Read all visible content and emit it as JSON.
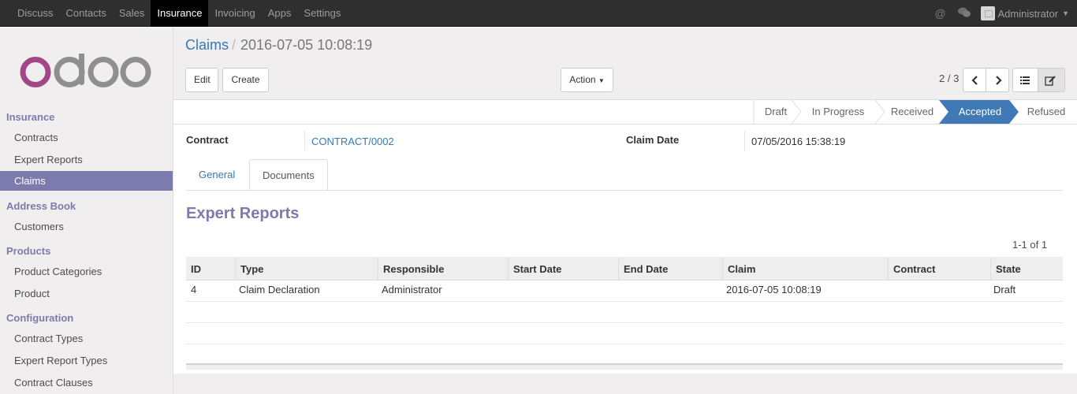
{
  "topbar": {
    "menu": [
      "Discuss",
      "Contacts",
      "Sales",
      "Insurance",
      "Invoicing",
      "Apps",
      "Settings"
    ],
    "active_menu": "Insurance",
    "user": "Administrator"
  },
  "sidebar": {
    "sections": [
      {
        "title": "Insurance",
        "items": [
          "Contracts",
          "Expert Reports",
          "Claims"
        ]
      },
      {
        "title": "Address Book",
        "items": [
          "Customers"
        ]
      },
      {
        "title": "Products",
        "items": [
          "Product Categories",
          "Product"
        ]
      },
      {
        "title": "Configuration",
        "items": [
          "Contract Types",
          "Expert Report Types",
          "Contract Clauses"
        ]
      }
    ],
    "active_item": "Claims"
  },
  "breadcrumb": {
    "parent": "Claims",
    "current": "2016-07-05 10:08:19"
  },
  "buttons": {
    "edit": "Edit",
    "create": "Create",
    "action": "Action"
  },
  "pager": "2 / 3",
  "statusbar": {
    "stages": [
      "Draft",
      "In Progress",
      "Received",
      "Accepted",
      "Refused"
    ],
    "active": "Accepted"
  },
  "form": {
    "contract_label": "Contract",
    "contract_value": "CONTRACT/0002",
    "claim_date_label": "Claim Date",
    "claim_date_value": "07/05/2016 15:38:19"
  },
  "tabs": [
    "General",
    "Documents"
  ],
  "active_tab": "Documents",
  "expert_reports": {
    "title": "Expert Reports",
    "pager": "1-1 of 1",
    "columns": [
      "ID",
      "Type",
      "Responsible",
      "Start Date",
      "End Date",
      "Claim",
      "Contract",
      "State"
    ],
    "rows": [
      [
        "4",
        "Claim Declaration",
        "Administrator",
        "",
        "",
        "2016-07-05 10:08:19",
        "",
        "Draft"
      ]
    ]
  },
  "colors": {
    "accent": "#7c7bad",
    "link": "#337ab7",
    "status_active": "#3f7ab7"
  }
}
